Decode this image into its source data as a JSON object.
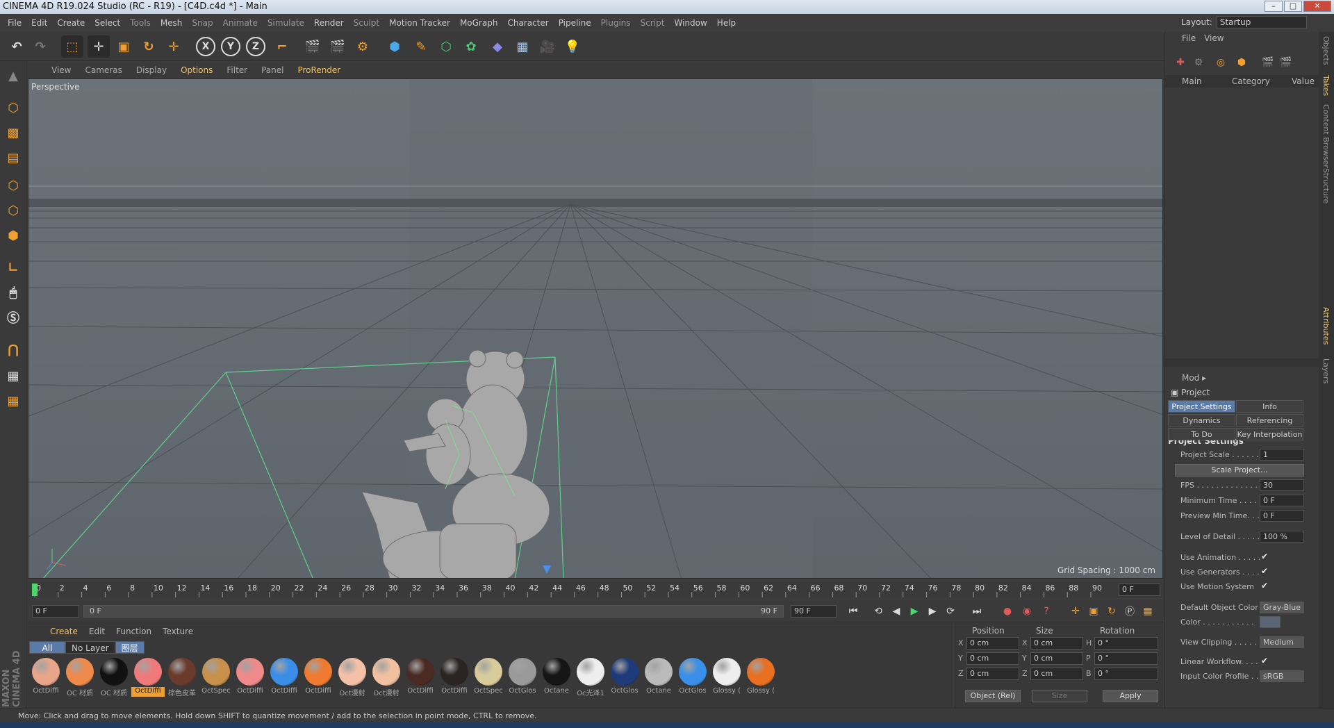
{
  "window": {
    "title": "CINEMA 4D R19.024 Studio (RC - R19) - [C4D.c4d *] - Main"
  },
  "menu": [
    "File",
    "Edit",
    "Create",
    "Select",
    "Tools",
    "Mesh",
    "Snap",
    "Animate",
    "Simulate",
    "Render",
    "Sculpt",
    "Motion Tracker",
    "MoGraph",
    "Character",
    "Pipeline",
    "Plugins",
    "Script",
    "Window",
    "Help"
  ],
  "layout": {
    "label": "Layout:",
    "value": "Startup"
  },
  "viewport": {
    "menu": [
      "View",
      "Cameras",
      "Display",
      "Options",
      "Filter",
      "Panel",
      "ProRender"
    ],
    "name": "Perspective",
    "grid_spacing": "Grid Spacing : 1000 cm"
  },
  "timeline": {
    "ticks": [
      "0",
      "2",
      "4",
      "6",
      "8",
      "10",
      "12",
      "14",
      "16",
      "18",
      "20",
      "22",
      "24",
      "26",
      "28",
      "30",
      "32",
      "34",
      "36",
      "38",
      "40",
      "42",
      "44",
      "46",
      "48",
      "50",
      "52",
      "54",
      "56",
      "58",
      "60",
      "62",
      "64",
      "66",
      "68",
      "70",
      "72",
      "74",
      "76",
      "78",
      "80",
      "82",
      "84",
      "86",
      "88",
      "90"
    ],
    "current_frame": "0 F",
    "start": "0 F",
    "range_start": "0 F",
    "range_end": "90 F",
    "end": "90 F"
  },
  "materials": {
    "menu": [
      "Create",
      "Edit",
      "Function",
      "Texture"
    ],
    "tabs": [
      "All",
      "No Layer",
      "图层"
    ],
    "items": [
      {
        "name": "OctDiffi",
        "color": "#e8a58a"
      },
      {
        "name": "OC 材质",
        "color": "#f08a4a"
      },
      {
        "name": "OC 材质",
        "color": "#111111"
      },
      {
        "name": "OctDiffi",
        "color": "#f07a7a",
        "selected": true
      },
      {
        "name": "棕色皮革",
        "color": "#6a3a2a"
      },
      {
        "name": "OctSpec",
        "color": "#c8904a"
      },
      {
        "name": "OctDiffi",
        "color": "#f08a8a"
      },
      {
        "name": "OctDiffi",
        "color": "#3a8ee8"
      },
      {
        "name": "OctDiffi",
        "color": "#f07a30"
      },
      {
        "name": "Oct漫射",
        "color": "#f4c0a8"
      },
      {
        "name": "Oct漫射",
        "color": "#f0c0a0"
      },
      {
        "name": "OctDiffi",
        "color": "#4a2a22"
      },
      {
        "name": "OctDiffi",
        "color": "#2a2422"
      },
      {
        "name": "OctSpec",
        "color": "#d8cc9a"
      },
      {
        "name": "OctGlos",
        "color": "#9a9a9a"
      },
      {
        "name": "Octane",
        "color": "#151515"
      },
      {
        "name": "Oc光泽1",
        "color": "#eeeeee"
      },
      {
        "name": "OctGlos",
        "color": "#1e3a7a"
      },
      {
        "name": "Octane",
        "color": "#bbbbbb"
      },
      {
        "name": "OctGlos",
        "color": "#3a90e8"
      },
      {
        "name": "Glossy (",
        "color": "#eeeeee"
      },
      {
        "name": "Glossy (",
        "color": "#e87020"
      }
    ]
  },
  "coords": {
    "headers": {
      "position": "Position",
      "size": "Size",
      "rotation": "Rotation"
    },
    "rows": [
      {
        "axis": "X",
        "pos": "0 cm",
        "saxis": "X",
        "size": "0 cm",
        "raxis": "H",
        "rot": "0 °"
      },
      {
        "axis": "Y",
        "pos": "0 cm",
        "saxis": "Y",
        "size": "0 cm",
        "raxis": "P",
        "rot": "0 °"
      },
      {
        "axis": "Z",
        "pos": "0 cm",
        "saxis": "Z",
        "size": "0 cm",
        "raxis": "B",
        "rot": "0 °"
      }
    ],
    "mode": "Object (Rel)",
    "size_mode": "Size",
    "apply": "Apply"
  },
  "objects": {
    "menu": [
      "File",
      "View"
    ],
    "cols": {
      "main": "Main",
      "category": "Category",
      "value": "Value"
    }
  },
  "attributes": {
    "mode": "Mod",
    "object": "Project",
    "tabs": [
      "Project Settings",
      "Info",
      "Dynamics",
      "Referencing",
      "To Do",
      "Key Interpolation"
    ],
    "section": "Project Settings",
    "fields": {
      "project_scale": {
        "label": "Project Scale . . . . . .",
        "value": "1"
      },
      "scale_button": "Scale Project...",
      "fps": {
        "label": "FPS . . . . . . . . . . . . . .",
        "value": "30"
      },
      "min_time": {
        "label": "Minimum Time . . . .",
        "value": "0 F"
      },
      "preview_min": {
        "label": "Preview Min Time. . .",
        "value": "0 F"
      },
      "lod": {
        "label": "Level of Detail . . . . .",
        "value": "100 %"
      },
      "use_animation": {
        "label": "Use Animation . . . . .",
        "check": "✔"
      },
      "use_generators": {
        "label": "Use Generators . . . .",
        "check": "✔"
      },
      "use_motion": {
        "label": "Use Motion System",
        "check": "✔"
      },
      "default_color": {
        "label": "Default Object Color",
        "value": "Gray-Blue"
      },
      "color": {
        "label": "Color . . . . . . . . . . ."
      },
      "view_clipping": {
        "label": "View Clipping . . . . .",
        "value": "Medium"
      },
      "linear_workflow": {
        "label": "Linear Workflow. . . .",
        "check": "✔"
      },
      "input_profile": {
        "label": "Input Color Profile . .",
        "value": "sRGB"
      }
    }
  },
  "side_tabs": [
    "Objects",
    "Takes",
    "Content Browser",
    "Structure",
    "Attributes",
    "Layers"
  ],
  "status": "Move: Click and drag to move elements. Hold down SHIFT to quantize movement / add to the selection in point mode, CTRL to remove.",
  "logo": "MAXON CINEMA 4D"
}
